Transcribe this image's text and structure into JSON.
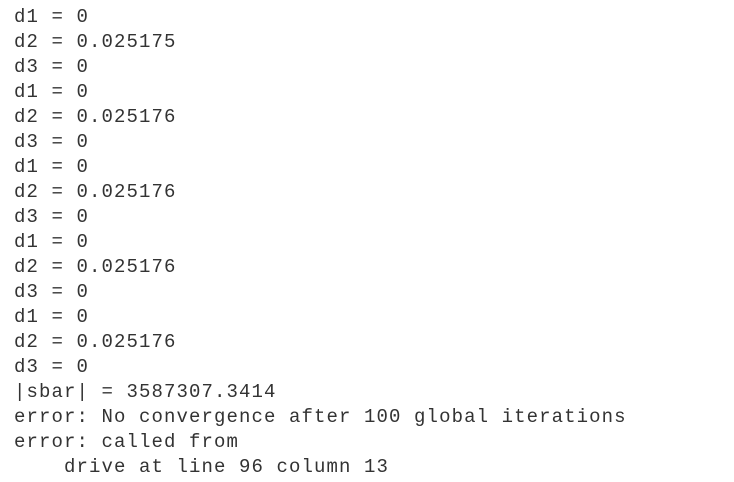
{
  "console": {
    "lines": [
      "d1 = 0",
      "d2 = 0.025175",
      "d3 = 0",
      "d1 = 0",
      "d2 = 0.025176",
      "d3 = 0",
      "d1 = 0",
      "d2 = 0.025176",
      "d3 = 0",
      "d1 = 0",
      "d2 = 0.025176",
      "d3 = 0",
      "d1 = 0",
      "d2 = 0.025176",
      "d3 = 0",
      "|sbar| = 3587307.3414",
      "error: No convergence after 100 global iterations",
      "error: called from",
      "    drive at line 96 column 13"
    ]
  }
}
